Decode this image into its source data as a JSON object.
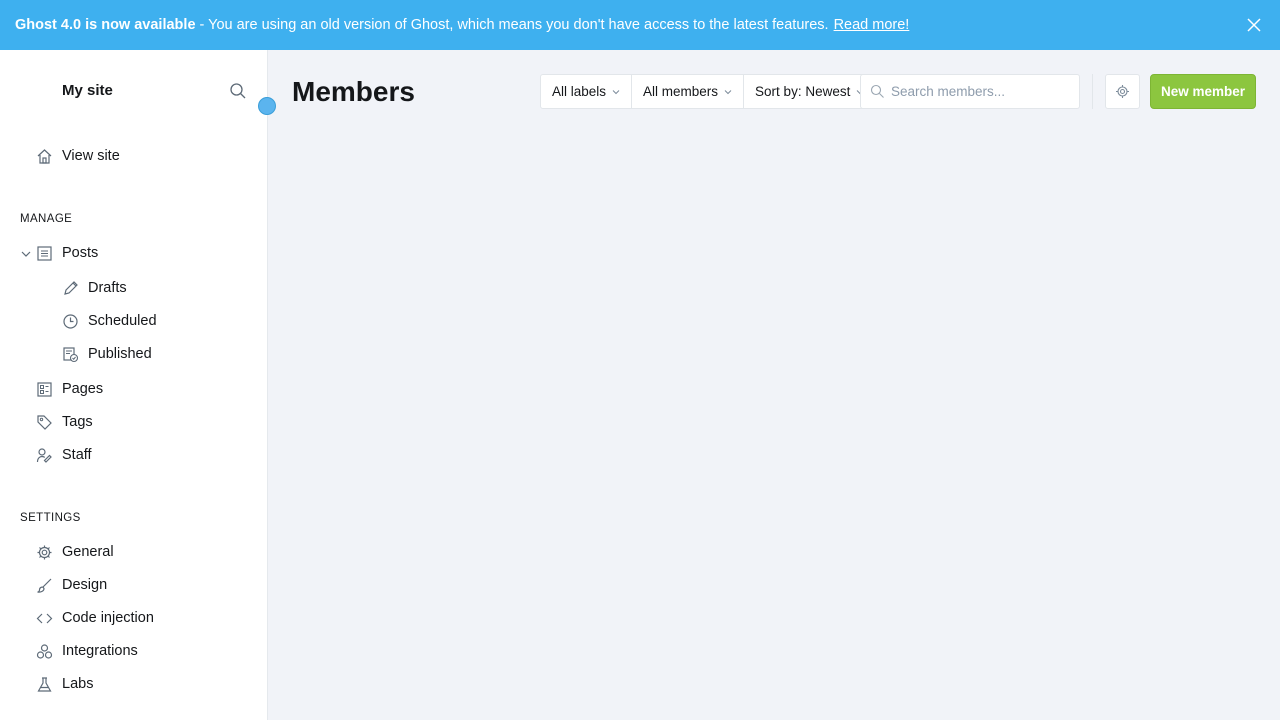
{
  "banner": {
    "title": "Ghost 4.0 is now available",
    "message": "- You are using an old version of Ghost, which means you don't have access to the latest features.",
    "link": "Read more!"
  },
  "sidebar": {
    "site_title": "My site",
    "view_site": "View site",
    "manage_heading": "MANAGE",
    "posts": "Posts",
    "drafts": "Drafts",
    "scheduled": "Scheduled",
    "published": "Published",
    "pages": "Pages",
    "tags": "Tags",
    "staff": "Staff",
    "settings_heading": "SETTINGS",
    "general": "General",
    "design": "Design",
    "code_injection": "Code injection",
    "integrations": "Integrations",
    "labs": "Labs"
  },
  "main": {
    "title": "Members",
    "filters": {
      "labels": "All labels",
      "members": "All members",
      "sort": "Sort by: Newest"
    },
    "search_placeholder": "Search members...",
    "new_member": "New member"
  },
  "colors": {
    "banner": "#3eb0ef",
    "primary_button": "#8cc63f"
  }
}
